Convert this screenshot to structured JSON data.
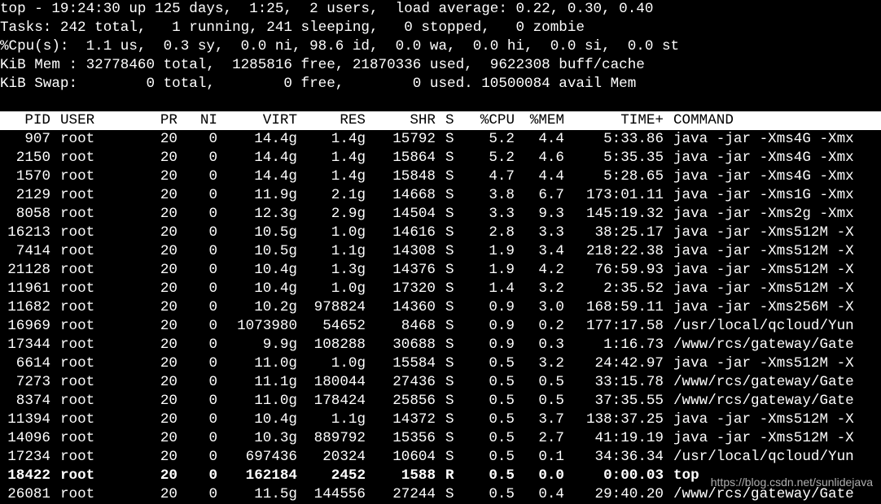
{
  "summary": [
    "top - 19:24:30 up 125 days,  1:25,  2 users,  load average: 0.22, 0.30, 0.40",
    "Tasks: 242 total,   1 running, 241 sleeping,   0 stopped,   0 zombie",
    "%Cpu(s):  1.1 us,  0.3 sy,  0.0 ni, 98.6 id,  0.0 wa,  0.0 hi,  0.0 si,  0.0 st",
    "KiB Mem : 32778460 total,  1285816 free, 21870336 used,  9622308 buff/cache",
    "KiB Swap:        0 total,        0 free,        0 used. 10500084 avail Mem"
  ],
  "columns": [
    "PID",
    "USER",
    "PR",
    "NI",
    "VIRT",
    "RES",
    "SHR",
    "S",
    "%CPU",
    "%MEM",
    "TIME+",
    "COMMAND"
  ],
  "processes": [
    [
      "907",
      "root",
      "20",
      "0",
      "14.4g",
      "1.4g",
      "15792",
      "S",
      "5.2",
      "4.4",
      "5:33.86",
      "java -jar -Xms4G -Xmx"
    ],
    [
      "2150",
      "root",
      "20",
      "0",
      "14.4g",
      "1.4g",
      "15864",
      "S",
      "5.2",
      "4.6",
      "5:35.35",
      "java -jar -Xms4G -Xmx"
    ],
    [
      "1570",
      "root",
      "20",
      "0",
      "14.4g",
      "1.4g",
      "15848",
      "S",
      "4.7",
      "4.4",
      "5:28.65",
      "java -jar -Xms4G -Xmx"
    ],
    [
      "2129",
      "root",
      "20",
      "0",
      "11.9g",
      "2.1g",
      "14668",
      "S",
      "3.8",
      "6.7",
      "173:01.11",
      "java -jar -Xms1G -Xmx"
    ],
    [
      "8058",
      "root",
      "20",
      "0",
      "12.3g",
      "2.9g",
      "14504",
      "S",
      "3.3",
      "9.3",
      "145:19.32",
      "java -jar -Xms2g -Xmx"
    ],
    [
      "16213",
      "root",
      "20",
      "0",
      "10.5g",
      "1.0g",
      "14616",
      "S",
      "2.8",
      "3.3",
      "38:25.17",
      "java -jar -Xms512M -X"
    ],
    [
      "7414",
      "root",
      "20",
      "0",
      "10.5g",
      "1.1g",
      "14308",
      "S",
      "1.9",
      "3.4",
      "218:22.38",
      "java -jar -Xms512M -X"
    ],
    [
      "21128",
      "root",
      "20",
      "0",
      "10.4g",
      "1.3g",
      "14376",
      "S",
      "1.9",
      "4.2",
      "76:59.93",
      "java -jar -Xms512M -X"
    ],
    [
      "11961",
      "root",
      "20",
      "0",
      "10.4g",
      "1.0g",
      "17320",
      "S",
      "1.4",
      "3.2",
      "2:35.52",
      "java -jar -Xms512M -X"
    ],
    [
      "11682",
      "root",
      "20",
      "0",
      "10.2g",
      "978824",
      "14360",
      "S",
      "0.9",
      "3.0",
      "168:59.11",
      "java -jar -Xms256M -X"
    ],
    [
      "16969",
      "root",
      "20",
      "0",
      "1073980",
      "54652",
      "8468",
      "S",
      "0.9",
      "0.2",
      "177:17.58",
      "/usr/local/qcloud/Yun"
    ],
    [
      "17344",
      "root",
      "20",
      "0",
      "9.9g",
      "108288",
      "30688",
      "S",
      "0.9",
      "0.3",
      "1:16.73",
      "/www/rcs/gateway/Gate"
    ],
    [
      "6614",
      "root",
      "20",
      "0",
      "11.0g",
      "1.0g",
      "15584",
      "S",
      "0.5",
      "3.2",
      "24:42.97",
      "java -jar -Xms512M -X"
    ],
    [
      "7273",
      "root",
      "20",
      "0",
      "11.1g",
      "180044",
      "27436",
      "S",
      "0.5",
      "0.5",
      "33:15.78",
      "/www/rcs/gateway/Gate"
    ],
    [
      "8374",
      "root",
      "20",
      "0",
      "11.0g",
      "178424",
      "25856",
      "S",
      "0.5",
      "0.5",
      "37:35.55",
      "/www/rcs/gateway/Gate"
    ],
    [
      "11394",
      "root",
      "20",
      "0",
      "10.4g",
      "1.1g",
      "14372",
      "S",
      "0.5",
      "3.7",
      "138:37.25",
      "java -jar -Xms512M -X"
    ],
    [
      "14096",
      "root",
      "20",
      "0",
      "10.3g",
      "889792",
      "15356",
      "S",
      "0.5",
      "2.7",
      "41:19.19",
      "java -jar -Xms512M -X"
    ],
    [
      "17234",
      "root",
      "20",
      "0",
      "697436",
      "20324",
      "10604",
      "S",
      "0.5",
      "0.1",
      "34:36.34",
      "/usr/local/qcloud/Yun"
    ],
    [
      "18422",
      "root",
      "20",
      "0",
      "162184",
      "2452",
      "1588",
      "R",
      "0.5",
      "0.0",
      "0:00.03",
      "top"
    ],
    [
      "26081",
      "root",
      "20",
      "0",
      "11.5g",
      "144556",
      "27244",
      "S",
      "0.5",
      "0.4",
      "29:40.20",
      "/www/rcs/gateway/Gate"
    ]
  ],
  "bold_row_index": 18,
  "watermark": "https://blog.csdn.net/sunlidejava"
}
